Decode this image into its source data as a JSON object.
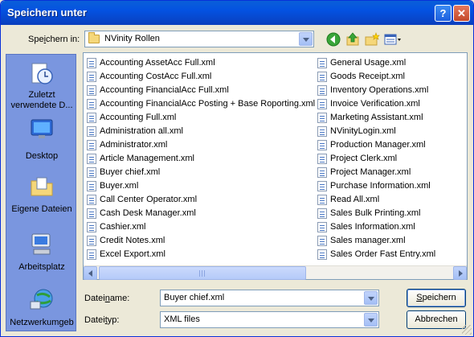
{
  "window": {
    "title": "Speichern unter",
    "help_glyph": "?",
    "close_glyph": "✕"
  },
  "savein": {
    "label_pre": "Spe",
    "label_ul": "i",
    "label_post": "chern in:",
    "value": "NVinity Rollen"
  },
  "toolbar": {
    "icons": [
      "back-icon",
      "up-folder-icon",
      "new-folder-icon",
      "view-menu-icon"
    ]
  },
  "places": [
    {
      "label": "Zuletzt verwendete D...",
      "icon": "recent-documents-icon"
    },
    {
      "label": "Desktop",
      "icon": "desktop-icon"
    },
    {
      "label": "Eigene Dateien",
      "icon": "my-documents-icon"
    },
    {
      "label": "Arbeitsplatz",
      "icon": "my-computer-icon"
    },
    {
      "label": "Netzwerkumgeb",
      "icon": "network-icon"
    }
  ],
  "files_col1": [
    "Accounting AssetAcc Full.xml",
    "Accounting CostAcc Full.xml",
    "Accounting FinancialAcc Full.xml",
    "Accounting FinancialAcc Posting + Base Roporting.xml",
    "Accounting Full.xml",
    "Administration all.xml",
    "Administrator.xml",
    "Article Management.xml",
    "Buyer chief.xml",
    "Buyer.xml",
    "Call Center Operator.xml",
    "Cash Desk Manager.xml",
    "Cashier.xml",
    "Credit Notes.xml",
    "Excel Export.xml"
  ],
  "files_col2": [
    "General Usage.xml",
    "Goods Receipt.xml",
    "Inventory Operations.xml",
    "Invoice Verification.xml",
    "Marketing Assistant.xml",
    "NVinityLogin.xml",
    "Production Manager.xml",
    "Project Clerk.xml",
    "Project Manager.xml",
    "Purchase Information.xml",
    "Read All.xml",
    "Sales Bulk Printing.xml",
    "Sales Information.xml",
    "Sales manager.xml",
    "Sales Order Fast Entry.xml"
  ],
  "filename": {
    "label_pre": "Datei",
    "label_ul": "n",
    "label_post": "ame:",
    "value": "Buyer chief.xml"
  },
  "filetype": {
    "label_pre": "Datei",
    "label_ul": "t",
    "label_post": "yp:",
    "value": "XML files"
  },
  "buttons": {
    "save_ul": "S",
    "save_rest": "peichern",
    "cancel": "Abbrechen"
  },
  "colors": {
    "titlebar": "#0a5fd8",
    "places_bg": "#7a96df",
    "dialog_bg": "#ece9d8"
  }
}
